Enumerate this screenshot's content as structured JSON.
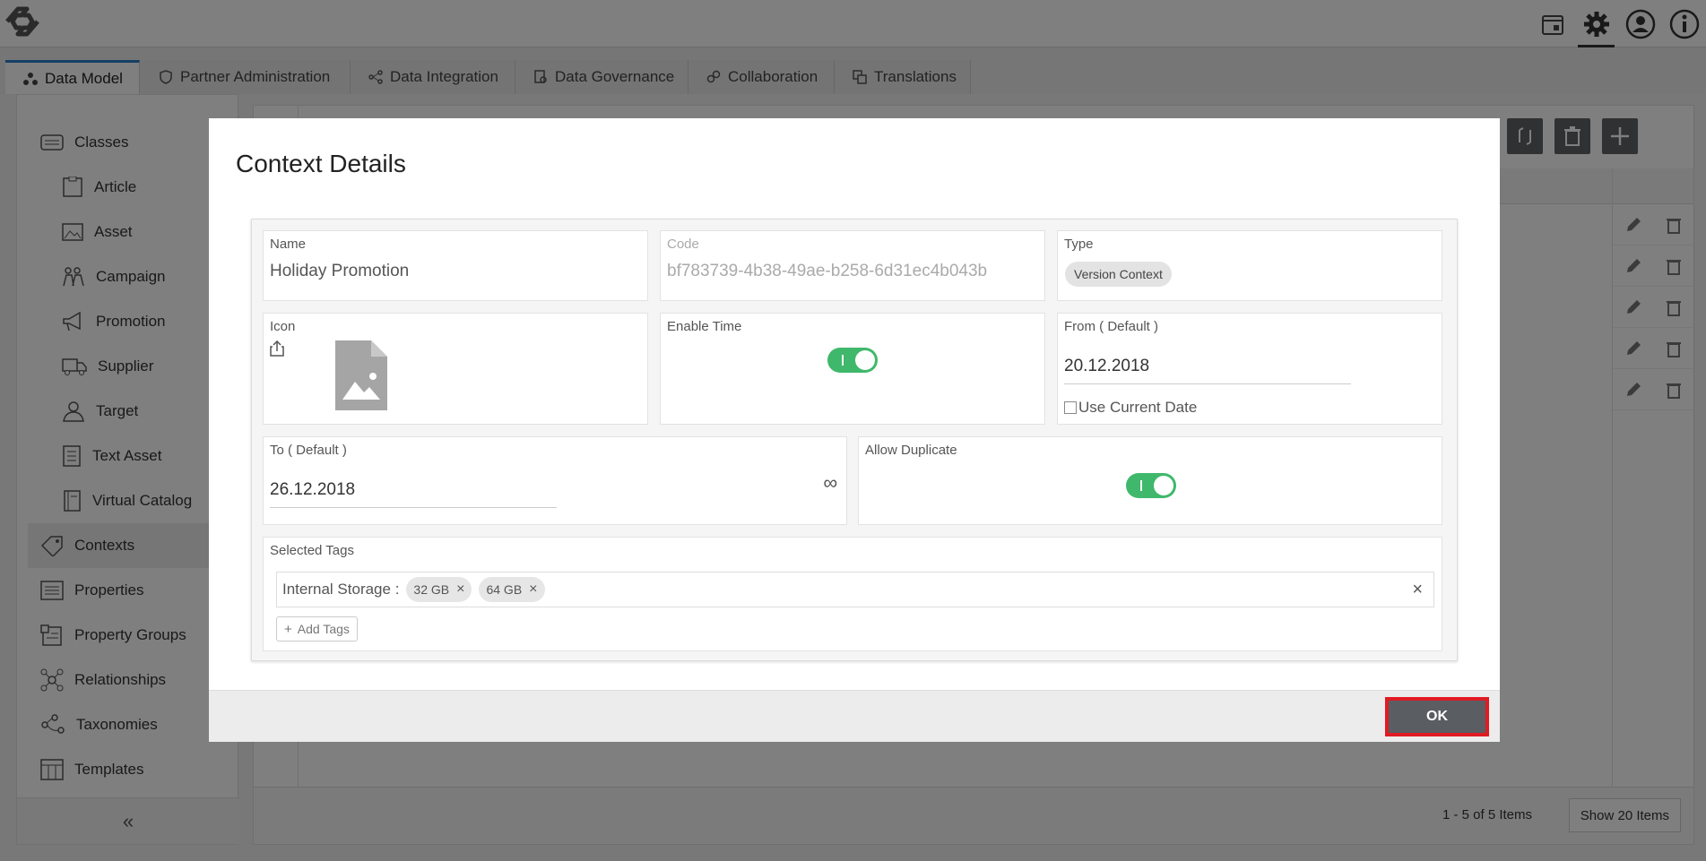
{
  "topbar": {
    "icons": [
      "logo-icon",
      "calendar-icon",
      "gear-icon",
      "user-icon",
      "info-icon"
    ]
  },
  "tabs": [
    {
      "label": "Data Model",
      "icon": "data-model-icon",
      "active": true
    },
    {
      "label": "Partner Administration",
      "icon": "shield-icon"
    },
    {
      "label": "Data Integration",
      "icon": "integration-icon"
    },
    {
      "label": "Data Governance",
      "icon": "governance-icon"
    },
    {
      "label": "Collaboration",
      "icon": "collaboration-icon"
    },
    {
      "label": "Translations",
      "icon": "translations-icon"
    }
  ],
  "sidebar": {
    "items": [
      {
        "label": "Classes",
        "icon": "classes-icon"
      },
      {
        "label": "Article",
        "icon": "article-icon"
      },
      {
        "label": "Asset",
        "icon": "asset-icon"
      },
      {
        "label": "Campaign",
        "icon": "campaign-icon"
      },
      {
        "label": "Promotion",
        "icon": "megaphone-icon"
      },
      {
        "label": "Supplier",
        "icon": "truck-icon"
      },
      {
        "label": "Target",
        "icon": "target-icon"
      },
      {
        "label": "Text Asset",
        "icon": "text-asset-icon"
      },
      {
        "label": "Virtual Catalog",
        "icon": "catalog-icon"
      },
      {
        "label": "Contexts",
        "icon": "tag-icon"
      },
      {
        "label": "Properties",
        "icon": "properties-icon"
      },
      {
        "label": "Property Groups",
        "icon": "property-groups-icon"
      },
      {
        "label": "Relationships",
        "icon": "relationships-icon"
      },
      {
        "label": "Taxonomies",
        "icon": "taxonomies-icon"
      },
      {
        "label": "Templates",
        "icon": "templates-icon"
      }
    ],
    "collapse": "«"
  },
  "grid": {
    "pager_text": "1 - 5 of 5 Items",
    "page_size_button": "Show 20 Items"
  },
  "modal": {
    "title": "Context Details",
    "name_label": "Name",
    "name_value": "Holiday Promotion",
    "code_label": "Code",
    "code_value": "bf783739-4b38-49ae-b258-6d31ec4b043b",
    "type_label": "Type",
    "type_value": "Version Context",
    "icon_label": "Icon",
    "enable_time_label": "Enable Time",
    "enable_time_on": true,
    "from_label": "From ( Default )",
    "from_value": "20.12.2018",
    "use_current_date_label": "Use Current Date",
    "use_current_date_checked": false,
    "to_label": "To ( Default )",
    "to_value": "26.12.2018",
    "infinity_symbol": "∞",
    "allow_duplicate_label": "Allow Duplicate",
    "allow_duplicate_on": true,
    "selected_tags_label": "Selected Tags",
    "tag_group_label": "Internal Storage :",
    "tags": [
      "32 GB",
      "64 GB"
    ],
    "tag_remove": "×",
    "clear_tags": "×",
    "add_tags_label": "Add Tags",
    "ok_label": "OK"
  }
}
